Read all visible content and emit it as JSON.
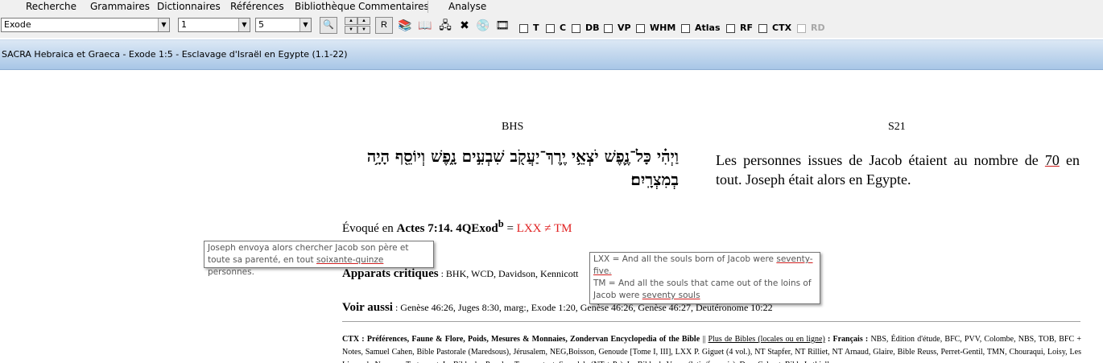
{
  "menu": {
    "items": [
      "Recherche",
      "Grammaires",
      "Dictionnaires",
      "Références",
      "Bibliothèque",
      "Commentaires",
      "Analyse"
    ]
  },
  "toolbar": {
    "book": "Exode",
    "chapter": "1",
    "verse": "5",
    "r_label": "R",
    "checkboxes": [
      "T",
      "C",
      "DB",
      "VP",
      "WHM",
      "Atlas",
      "RF",
      "CTX",
      "RD"
    ]
  },
  "title": "SACRA Hebraica et Graeca - Exode 1:5 - Esclavage d'Israël en Egypte (1.1-22)",
  "columns": {
    "left": "BHS",
    "right": "S21"
  },
  "hebrew_text": "וַיְהִ֗י כָּל־נֶ֛פֶשׁ יֹצְאֵ֥י יֶֽרֶךְ־יַעֲקֹ֖ב שִׁבְעִ֣ים נָ֑פֶשׁ וְיוֹסֵ֖ף הָיָ֥ה בְמִצְרָֽיִם׃",
  "french": {
    "before": "Les personnes issues de Jacob étaient au nombre de ",
    "number": "70",
    "after": " en tout. Joseph était alors en Egypte."
  },
  "evoque": {
    "prefix": "Évoqué en ",
    "ref": "Actes 7:14. 4QExod",
    "sup": "b",
    "eq": " = ",
    "comparison": "LXX ≠ TM"
  },
  "apparats": {
    "label": "Apparats critiques",
    "text": " : BHK, WCD, Davidson, Kennicott"
  },
  "voir": {
    "label": "Voir aussi",
    "text": " : Genèse 46:26, Juges 8:30, marg:, Exode 1:20, Genèse 46:26, Genèse 46:27, Deutéronome 10:22"
  },
  "ctx": {
    "label": "CTX :",
    "bold_links": "Préférences, Faune & Flore, Poids, Mesures & Monnaies, Zondervan Encyclopedia of the Bible",
    "sep": " || ",
    "plus": "Plus de Bibles (locales ou en ligne)",
    "francais_label": " : Français :",
    "francais_text": " NBS, Édition d'étude, BFC, PVV, Colombe, NBS, TOB, BFC + Notes, Samuel Cahen, Bible Pastorale (Maredsous), Jérusalem, NEG,Boisson, Genoude [Tome I, III], LXX P. Giguet (4 vol.), NT Stapfer, NT Rilliet, NT Arnaud, Glaire, Bible Reuss, Perret-Gentil, TMN, Chouraqui, Loisy, Les Livres du Nouveau Testament, La Bible des Peuples, Tresmontant, Synodale (NT + Ps), La Bible de Vence (latin/français), Dom Calmet, Bible Lethielleux"
  },
  "tooltip_joseph": {
    "before": "Joseph envoya alors chercher Jacob son père et toute sa parenté, en tout ",
    "highlight": "soixante-quinze",
    "after": " personnes."
  },
  "tooltip_lxx": {
    "lxx_before": "LXX = And all the souls born of Jacob were ",
    "lxx_highlight": "seventy-five.",
    "tm_before": " TM = And all the souls that came out of the loins of Jacob were ",
    "tm_highlight": "seventy souls"
  }
}
